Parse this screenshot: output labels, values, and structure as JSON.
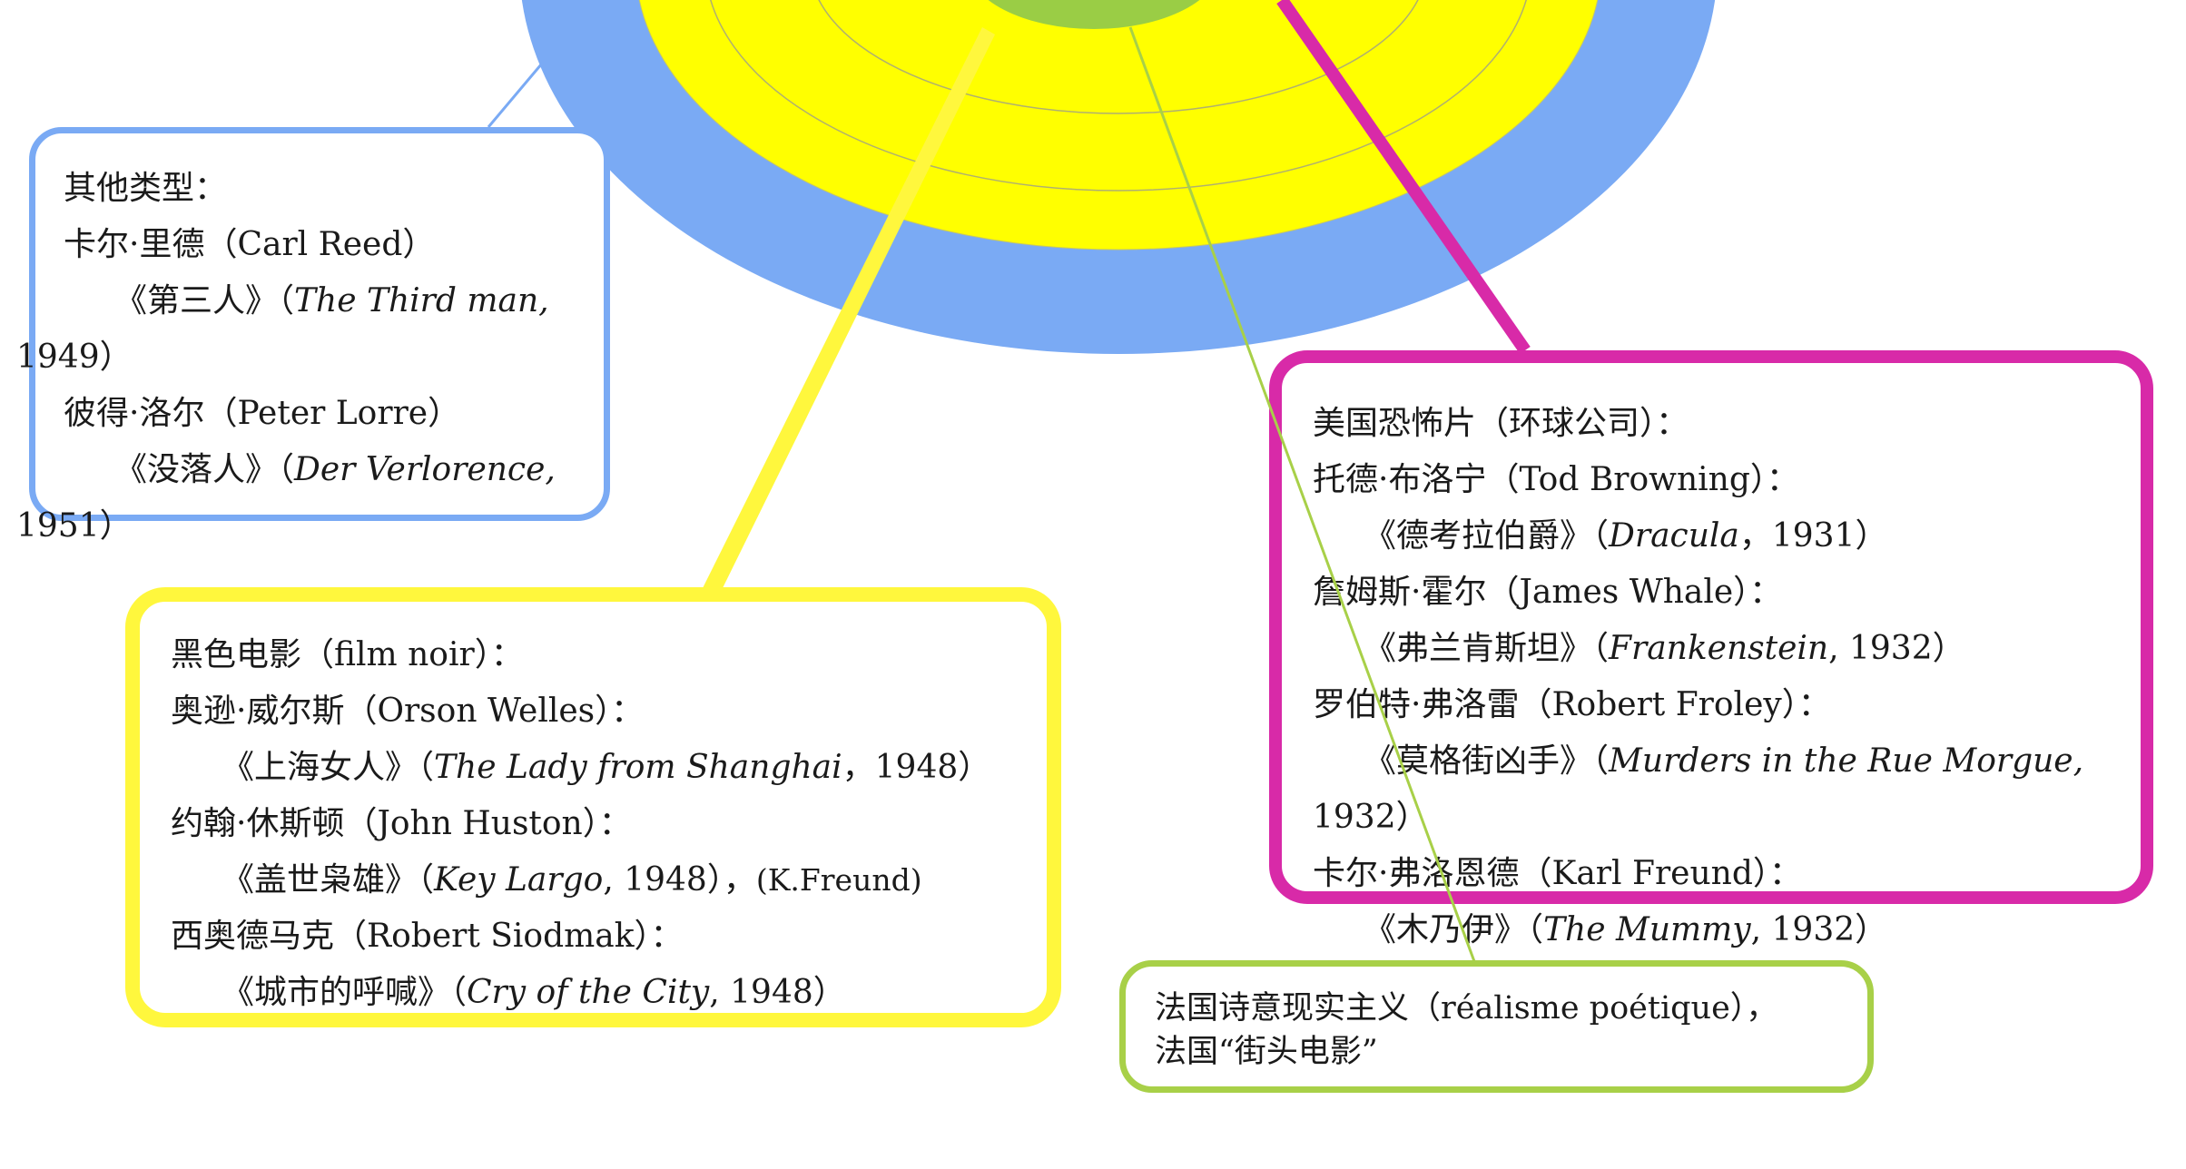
{
  "colors": {
    "blue": "#7aaaf4",
    "yellow": "#fff73d",
    "yellow_ring": "#ffff00",
    "magenta": "#d82aa8",
    "green": "#a8d048",
    "green_center": "#9acd45"
  },
  "other": {
    "title": "其他类型：",
    "director1": "卡尔·里德（Carl Reed）",
    "film1_pre": "《第三人》（",
    "film1_title": "The Third man,",
    "film1_post": "1949）",
    "director2": "彼得·洛尔（Peter Lorre）",
    "film2_pre": "《没落人》（",
    "film2_title": "Der Verlorence,",
    "film2_post": "1951）"
  },
  "noir": {
    "title": "黑色电影（film noir）：",
    "director1": "奥逊·威尔斯（Orson Welles）：",
    "film1_pre": "《上海女人》（",
    "film1_title": "The Lady from Shanghai",
    "film1_post": "，1948）",
    "director2": "约翰·休斯顿（John Huston）：",
    "film2_pre": "《盖世枭雄》（",
    "film2_title": "Key Largo",
    "film2_post": ", 1948），",
    "film2_extra": "(K.Freund)",
    "director3": "西奥德马克（Robert Siodmak）：",
    "film3_pre": "《城市的呼喊》（",
    "film3_title": "Cry of the City",
    "film3_post": ", 1948）"
  },
  "horror": {
    "title": "美国恐怖片（环球公司）：",
    "director1": "托德·布洛宁（Tod Browning）：",
    "film1_pre": "《德考拉伯爵》（",
    "film1_title": "Dracula",
    "film1_post": "，1931）",
    "director2": "詹姆斯·霍尔（James Whale）：",
    "film2_pre": "《弗兰肯斯坦》（",
    "film2_title": "Frankenstein",
    "film2_post": ", 1932）",
    "director3": "罗伯特·弗洛雷（Robert Froley）：",
    "film3_pre": "《莫格街凶手》（",
    "film3_title": "Murders in the Rue Morgue,",
    "film3_post": "1932）",
    "director4": "卡尔·弗洛恩德（Karl Freund）：",
    "film4_pre": "《木乃伊》（",
    "film4_title": "The Mummy",
    "film4_post": ", 1932）"
  },
  "french": {
    "line1": "法国诗意现实主义（réalisme poétique），",
    "line2": "法国“街头电影”"
  }
}
